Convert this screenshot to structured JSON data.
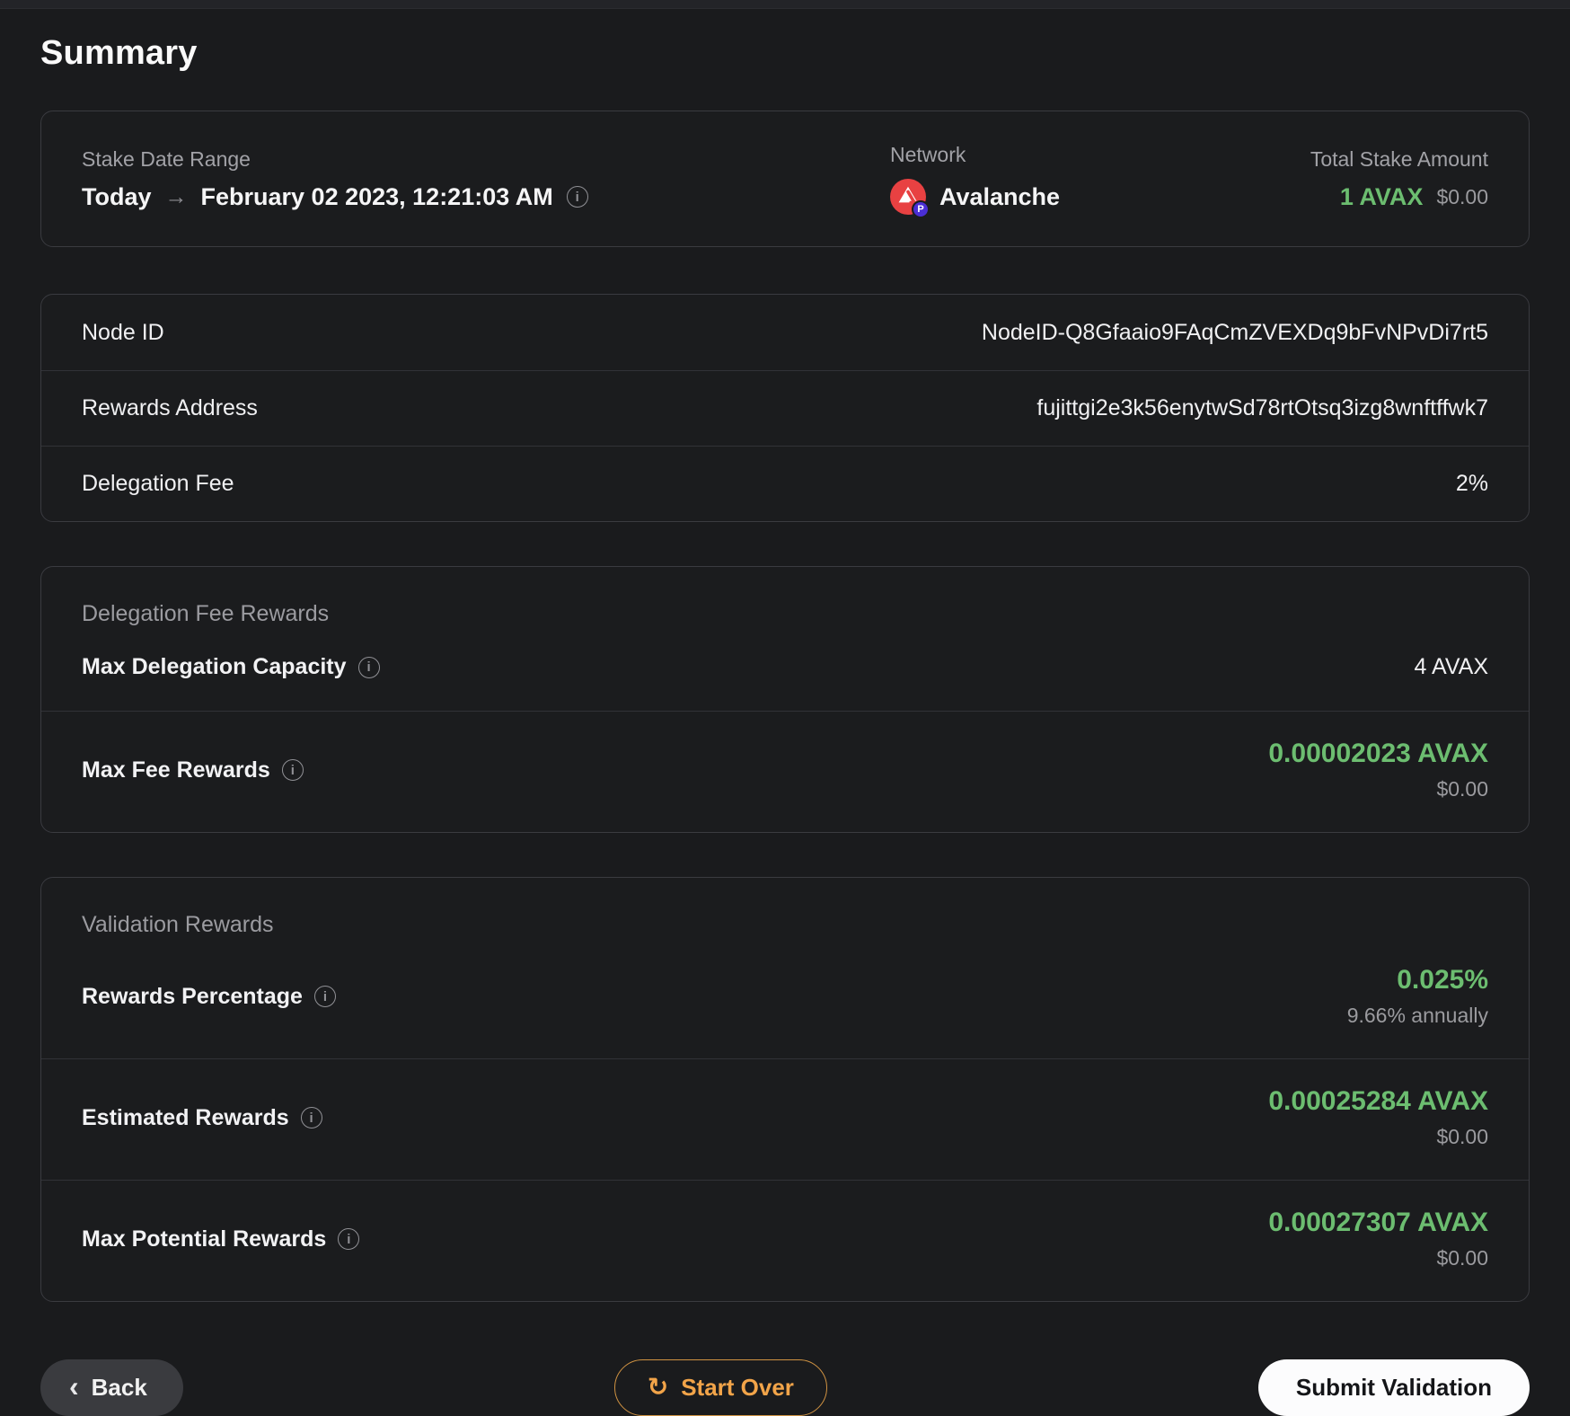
{
  "page": {
    "title": "Summary"
  },
  "colors": {
    "green": "#6cbd70",
    "orange": "#f2a449",
    "avalanche_red": "#e84142",
    "badge_purple": "#4a2ed6"
  },
  "icons": {
    "info": "i",
    "arrow_right": "→",
    "chevron_left": "‹",
    "refresh": "↻",
    "network_badge": "P"
  },
  "overview": {
    "stake": {
      "label": "Stake Date Range",
      "from": "Today",
      "to": "February 02 2023, 12:21:03 AM"
    },
    "network": {
      "label": "Network",
      "value": "Avalanche"
    },
    "total": {
      "label": "Total Stake Amount",
      "amount": "1 AVAX",
      "usd": "$0.00"
    }
  },
  "details": {
    "rows": [
      {
        "label": "Node ID",
        "value": "NodeID-Q8Gfaaio9FAqCmZVEXDq9bFvNPvDi7rt5"
      },
      {
        "label": "Rewards Address",
        "value": "fujittgi2e3k56enytwSd78rtOtsq3izg8wnftffwk7"
      },
      {
        "label": "Delegation Fee",
        "value": "2%"
      }
    ]
  },
  "fee_rewards": {
    "title": "Delegation Fee Rewards",
    "rows": [
      {
        "label": "Max Delegation Capacity",
        "value": "4 AVAX"
      },
      {
        "label": "Max Fee Rewards",
        "value": "0.00002023 AVAX",
        "usd": "$0.00"
      }
    ]
  },
  "validation": {
    "title": "Validation Rewards",
    "rows": [
      {
        "label": "Rewards Percentage",
        "value": "0.025%",
        "sub": "9.66% annually"
      },
      {
        "label": "Estimated Rewards",
        "value": "0.00025284 AVAX",
        "sub": "$0.00"
      },
      {
        "label": "Max Potential Rewards",
        "value": "0.00027307 AVAX",
        "sub": "$0.00"
      }
    ]
  },
  "footer": {
    "back_label": "Back",
    "start_over_label": "Start Over",
    "submit_label": "Submit Validation"
  }
}
